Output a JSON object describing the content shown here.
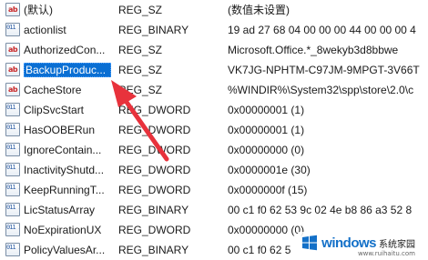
{
  "rows": [
    {
      "kind": "sz",
      "name": "(默认)",
      "type": "REG_SZ",
      "data": "(数值未设置)",
      "selected": false
    },
    {
      "kind": "bin",
      "name": "actionlist",
      "type": "REG_BINARY",
      "data": "19 ad 27 68 04 00 00 00 44 00 00 00 4",
      "selected": false
    },
    {
      "kind": "sz",
      "name": "AuthorizedCon...",
      "type": "REG_SZ",
      "data": "Microsoft.Office.*_8wekyb3d8bbwe",
      "selected": false
    },
    {
      "kind": "sz",
      "name": "BackupProduc...",
      "type": "REG_SZ",
      "data": "VK7JG-NPHTM-C97JM-9MPGT-3V66T",
      "selected": true
    },
    {
      "kind": "sz",
      "name": "CacheStore",
      "type": "REG_SZ",
      "data": "%WINDIR%\\System32\\spp\\store\\2.0\\c",
      "selected": false
    },
    {
      "kind": "bin",
      "name": "ClipSvcStart",
      "type": "REG_DWORD",
      "data": "0x00000001 (1)",
      "selected": false
    },
    {
      "kind": "bin",
      "name": "HasOOBERun",
      "type": "REG_DWORD",
      "data": "0x00000001 (1)",
      "selected": false
    },
    {
      "kind": "bin",
      "name": "IgnoreContain...",
      "type": "REG_DWORD",
      "data": "0x00000000 (0)",
      "selected": false
    },
    {
      "kind": "bin",
      "name": "InactivityShutd...",
      "type": "REG_DWORD",
      "data": "0x0000001e (30)",
      "selected": false
    },
    {
      "kind": "bin",
      "name": "KeepRunningT...",
      "type": "REG_DWORD",
      "data": "0x0000000f (15)",
      "selected": false
    },
    {
      "kind": "bin",
      "name": "LicStatusArray",
      "type": "REG_BINARY",
      "data": "00 c1 f0 62 53 9c 02 4e b8 86 a3 52 8",
      "selected": false
    },
    {
      "kind": "bin",
      "name": "NoExpirationUX",
      "type": "REG_DWORD",
      "data": "0x00000000 (0)",
      "selected": false
    },
    {
      "kind": "bin",
      "name": "PolicyValuesAr...",
      "type": "REG_BINARY",
      "data": "00 c1 f0 62 5",
      "selected": false
    }
  ],
  "icons": {
    "sz": "ab",
    "bin": "011 110"
  },
  "watermark": {
    "brand": "windows",
    "sub": "系统家园",
    "url": "www.ruihaitu.com",
    "color": "#1370c8"
  },
  "arrow_color": "#e8323c"
}
